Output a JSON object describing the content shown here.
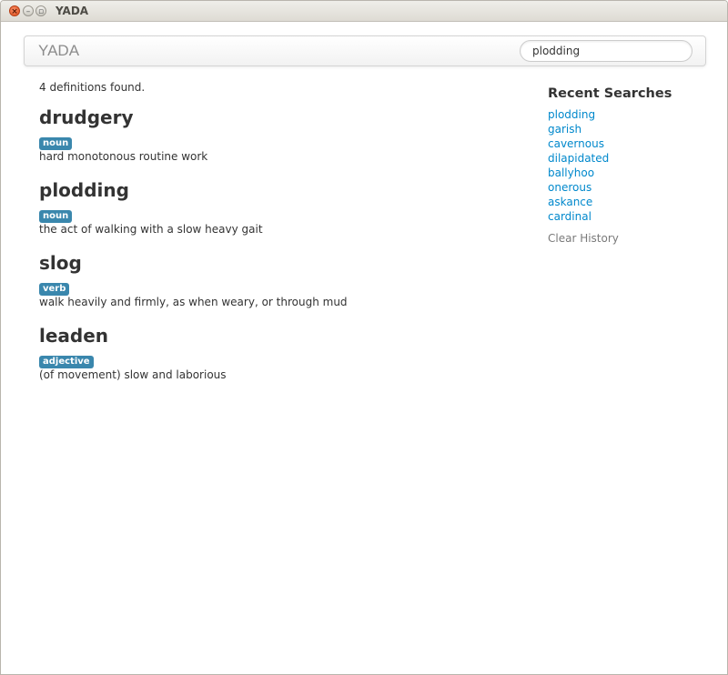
{
  "window": {
    "title": "YADA",
    "close_glyph": "×",
    "min_glyph": "–",
    "max_glyph": "▫"
  },
  "navbar": {
    "brand": "YADA",
    "search_value": "plodding"
  },
  "results": {
    "count_text": "4 definitions found.",
    "entries": [
      {
        "word": "drudgery",
        "pos": "noun",
        "definition": "hard monotonous routine work"
      },
      {
        "word": "plodding",
        "pos": "noun",
        "definition": "the act of walking with a slow heavy gait"
      },
      {
        "word": "slog",
        "pos": "verb",
        "definition": "walk heavily and firmly, as when weary, or through mud"
      },
      {
        "word": "leaden",
        "pos": "adjective",
        "definition": "(of movement) slow and laborious"
      }
    ]
  },
  "sidebar": {
    "title": "Recent Searches",
    "items": [
      "plodding",
      "garish",
      "cavernous",
      "dilapidated",
      "ballyhoo",
      "onerous",
      "askance",
      "cardinal"
    ],
    "clear_label": "Clear History"
  },
  "colors": {
    "label_bg": "#3a87ad",
    "link": "#0088cc",
    "muted_link": "#7a7a7a"
  }
}
